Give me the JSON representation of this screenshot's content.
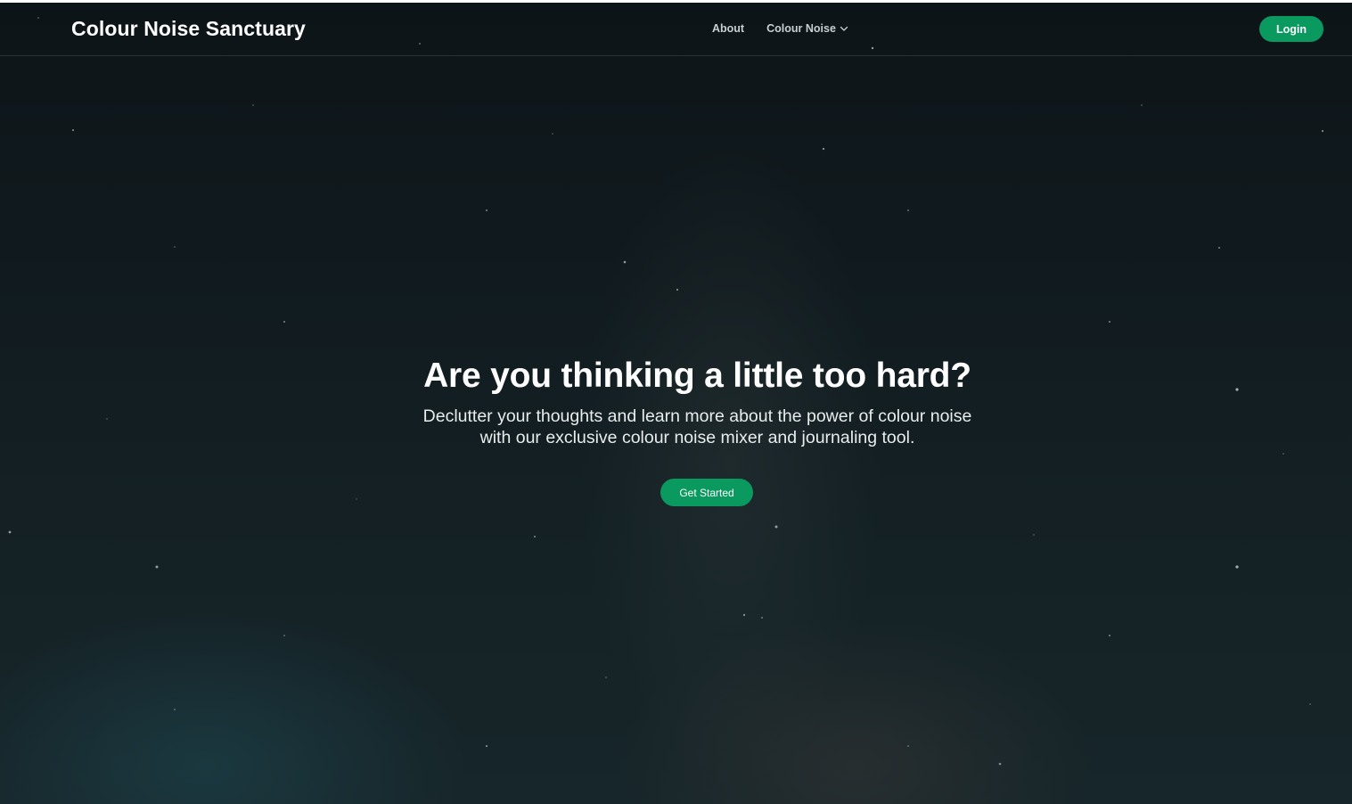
{
  "brand": {
    "name": "Colour Noise Sanctuary"
  },
  "nav": {
    "about_label": "About",
    "colour_noise_label": "Colour Noise",
    "login_label": "Login"
  },
  "hero": {
    "title": "Are you thinking a little too hard?",
    "subtitle_line1": "Declutter your thoughts and learn more about the power of colour noise",
    "subtitle_line2": "with our exclusive colour noise mixer and journaling tool.",
    "cta_label": "Get Started"
  },
  "colors": {
    "accent": "#0a9a5f",
    "background": "#101a1e",
    "text": "#ffffff"
  },
  "icons": {
    "dropdown": "chevron-down-icon"
  }
}
